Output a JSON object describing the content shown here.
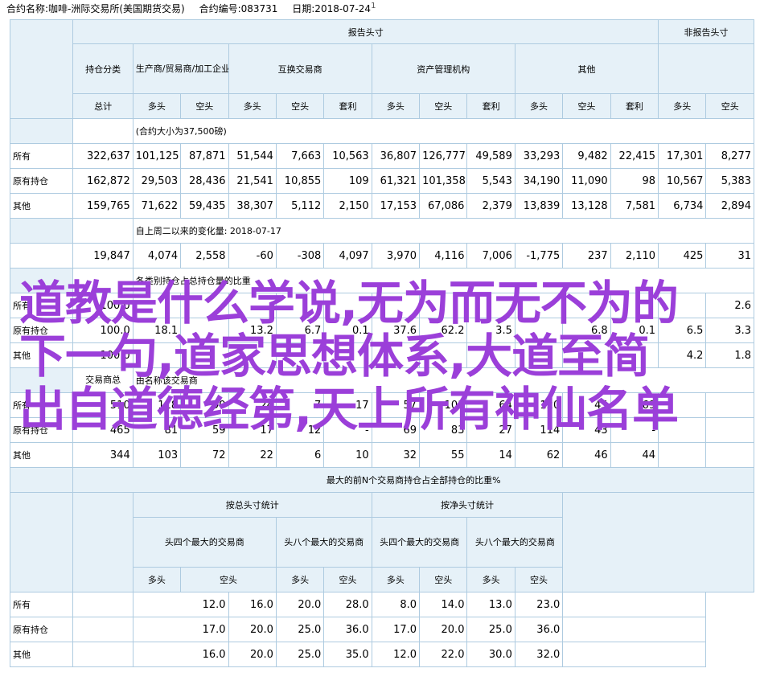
{
  "header": {
    "contract_name": "合约名称:咖啡-洲际交易所(美国期货交易)",
    "contract_code": "合约编号:083731",
    "date": "日期:2018-07-24",
    "marker": "1"
  },
  "labels": {
    "reportable": "报告头寸",
    "nonreportable": "非报告头寸",
    "position_category": "持仓分类",
    "producer": "生产商/贸易商/加工企业/用户",
    "swap": "互换交易商",
    "managed_money": "资产管理机构",
    "other": "其他",
    "total": "总计",
    "long": "多头",
    "short": "空头",
    "spread": "套利",
    "all": "所有",
    "old": "原有持仓",
    "other_row": "其他"
  },
  "sections": {
    "contract_unit": "(合约大小为37,500磅)",
    "change_since": "自上周二以来的变化量: 2018-07-17",
    "pct_oi": "各类别持仓占总持仓量的比重",
    "traders": "交易商总",
    "traders2": "由名称该交易商",
    "concentration": "最大的前N个交易商持仓占全部持仓的比重%",
    "gross": "按总头寸统计",
    "net": "按净头寸统计",
    "top4": "头四个最大的交易商",
    "top8": "头八个最大的交易商"
  },
  "rows": {
    "positions": [
      [
        "322,637",
        "101,125",
        "87,871",
        "51,544",
        "7,663",
        "10,563",
        "36,807",
        "126,777",
        "49,589",
        "33,293",
        "9,482",
        "22,415",
        "17,301",
        "8,277"
      ],
      [
        "162,872",
        "29,503",
        "28,436",
        "21,541",
        "10,855",
        "109",
        "61,321",
        "101,358",
        "5,543",
        "34,190",
        "11,090",
        "98",
        "10,567",
        "5,383"
      ],
      [
        "159,765",
        "71,622",
        "59,435",
        "38,307",
        "5,112",
        "2,150",
        "17,153",
        "67,086",
        "2,379",
        "13,839",
        "13,128",
        "7,581",
        "6,734",
        "2,894"
      ]
    ],
    "changes": [
      "19,847",
      "4,074",
      "2,558",
      "-60",
      "-308",
      "4,097",
      "3,970",
      "4,116",
      "7,006",
      "-1,775",
      "237",
      "2,110",
      "425",
      "31"
    ],
    "percent": [
      [
        "100.0",
        "",
        "",
        "",
        "",
        "",
        "",
        "",
        "",
        "",
        "",
        "",
        "",
        "2.6"
      ],
      [
        "100.0",
        "18.1",
        "",
        "13.2",
        "6.7",
        "0.1",
        "37.6",
        "62.2",
        "3.5",
        "",
        "6.8",
        "0.1",
        "6.5",
        "3.3"
      ],
      [
        "100.0",
        "",
        "",
        "",
        "",
        "",
        "",
        "",
        "",
        "",
        "",
        "",
        "4.2",
        "1.8"
      ]
    ],
    "traders": [
      [
        "510",
        "118",
        "90",
        "24",
        "7",
        "17",
        "57",
        "101",
        "64",
        "120",
        "45",
        "69",
        "",
        ""
      ],
      [
        "465",
        "81",
        "59",
        "17",
        "12",
        "-",
        "69",
        "83",
        "27",
        "114",
        "43",
        "-",
        "",
        ""
      ],
      [
        "344",
        "103",
        "72",
        "22",
        "6",
        "10",
        "32",
        "55",
        "14",
        "62",
        "46",
        "44",
        "",
        ""
      ]
    ],
    "concentration": [
      [
        "12.0",
        "16.0",
        "20.0",
        "28.0",
        "8.0",
        "14.0",
        "13.0",
        "23.0"
      ],
      [
        "17.0",
        "20.0",
        "25.0",
        "36.0",
        "17.0",
        "20.0",
        "25.0",
        "36.0"
      ],
      [
        "16.0",
        "20.0",
        "25.0",
        "35.0",
        "12.0",
        "22.0",
        "30.0",
        "32.0"
      ]
    ]
  },
  "overlay": {
    "line1": "道教是什么学说,无为而无不为的",
    "line2": "下一句,道家思想体系,大道至简",
    "line3": "出自道德经第,天上所有神仙名单"
  },
  "colors": {
    "header_fill": "#e6f1f8",
    "border": "#aecbe0",
    "overlay_text": "#9b3fd9"
  }
}
